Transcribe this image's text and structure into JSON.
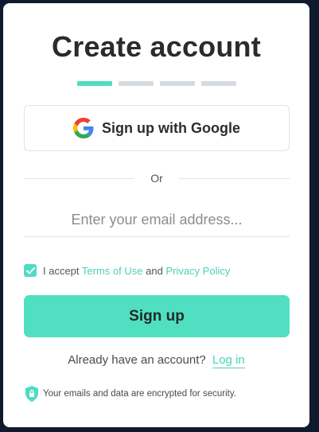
{
  "title": "Create account",
  "steps": {
    "total": 4,
    "active": 1
  },
  "google_button": {
    "label": "Sign up with Google",
    "icon": "google-icon"
  },
  "divider_text": "Or",
  "email": {
    "placeholder": "Enter your email address...",
    "value": ""
  },
  "terms": {
    "checked": true,
    "prefix": "I accept",
    "terms_link": "Terms of Use",
    "conjunction": "and",
    "privacy_link": "Privacy Policy"
  },
  "signup_button": {
    "label": "Sign up"
  },
  "login": {
    "prompt": "Already have an account?",
    "link": "Log in"
  },
  "security_note": "Your emails and data are encrypted for security.",
  "colors": {
    "accent": "#50dfc0",
    "link": "#4fd0b8",
    "step_inactive": "#d6dbe1",
    "background": "#0f1b2d"
  }
}
